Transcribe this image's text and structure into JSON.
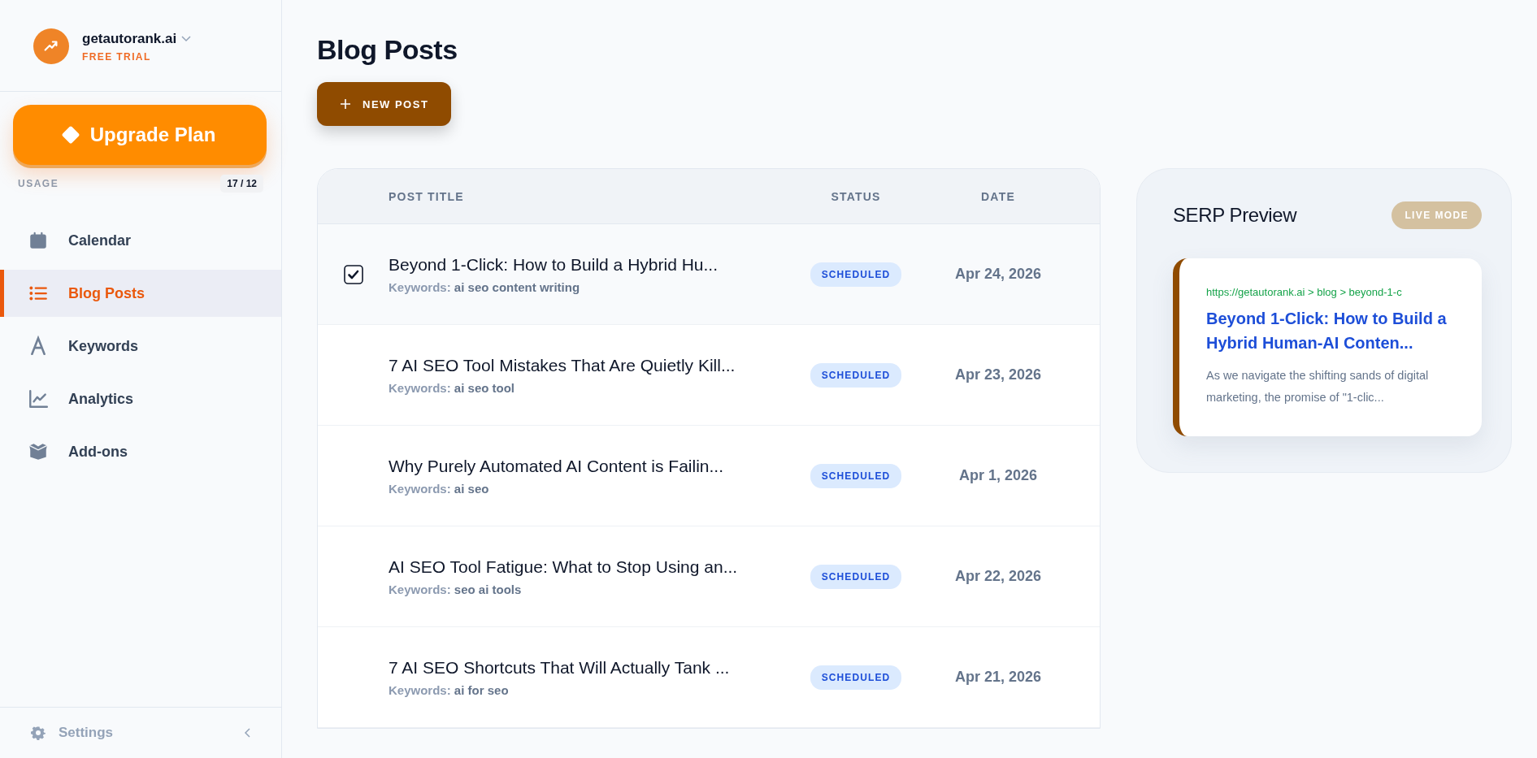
{
  "workspace": {
    "name": "getautorank.ai",
    "plan": "FREE TRIAL"
  },
  "upgrade_button": {
    "label": "Upgrade Plan"
  },
  "usage": {
    "label": "USAGE",
    "count": "17 / 12"
  },
  "nav": [
    {
      "label": "Calendar",
      "kind": "calendar",
      "selected": false
    },
    {
      "label": "Blog Posts",
      "kind": "list",
      "selected": true
    },
    {
      "label": "Keywords",
      "kind": "letter",
      "selected": false
    },
    {
      "label": "Analytics",
      "kind": "chart",
      "selected": false
    },
    {
      "label": "Add-ons",
      "kind": "box",
      "selected": false
    }
  ],
  "settings": {
    "label": "Settings"
  },
  "page_title": "Blog Posts",
  "new_post_button": {
    "label": "NEW POST"
  },
  "table": {
    "columns": [
      "POST TITLE",
      "STATUS",
      "DATE"
    ],
    "rows": [
      {
        "title": "Beyond 1-Click: How to Build a Hybrid Hu...",
        "keyword_label": "Keywords:",
        "keywords": "ai seo content writing",
        "status": "SCHEDULED",
        "date": "Apr 24, 2026",
        "selected": true
      },
      {
        "title": "7 AI SEO Tool Mistakes That Are Quietly Kill...",
        "keyword_label": "Keywords:",
        "keywords": "ai seo tool",
        "status": "SCHEDULED",
        "date": "Apr 23, 2026",
        "selected": false
      },
      {
        "title": "Why Purely Automated AI Content is Failin...",
        "keyword_label": "Keywords:",
        "keywords": "ai seo",
        "status": "SCHEDULED",
        "date": "Apr 1, 2026",
        "selected": false
      },
      {
        "title": "AI SEO Tool Fatigue: What to Stop Using an...",
        "keyword_label": "Keywords:",
        "keywords": "seo ai tools",
        "status": "SCHEDULED",
        "date": "Apr 22, 2026",
        "selected": false
      },
      {
        "title": "7 AI SEO Shortcuts That Will Actually Tank ...",
        "keyword_label": "Keywords:",
        "keywords": "ai for seo",
        "status": "SCHEDULED",
        "date": "Apr 21, 2026",
        "selected": false
      }
    ]
  },
  "serp_preview": {
    "title": "SERP Preview",
    "badge": "LIVE MODE",
    "url": [
      "https://getautorank.ai",
      ">",
      "blog",
      ">",
      "beyond-1-c"
    ],
    "headline": "Beyond 1-Click: How to Build a Hybrid Human-AI Conten...",
    "snippet": "As we navigate the shifting sands of digital marketing, the promise of \"1-clic..."
  }
}
